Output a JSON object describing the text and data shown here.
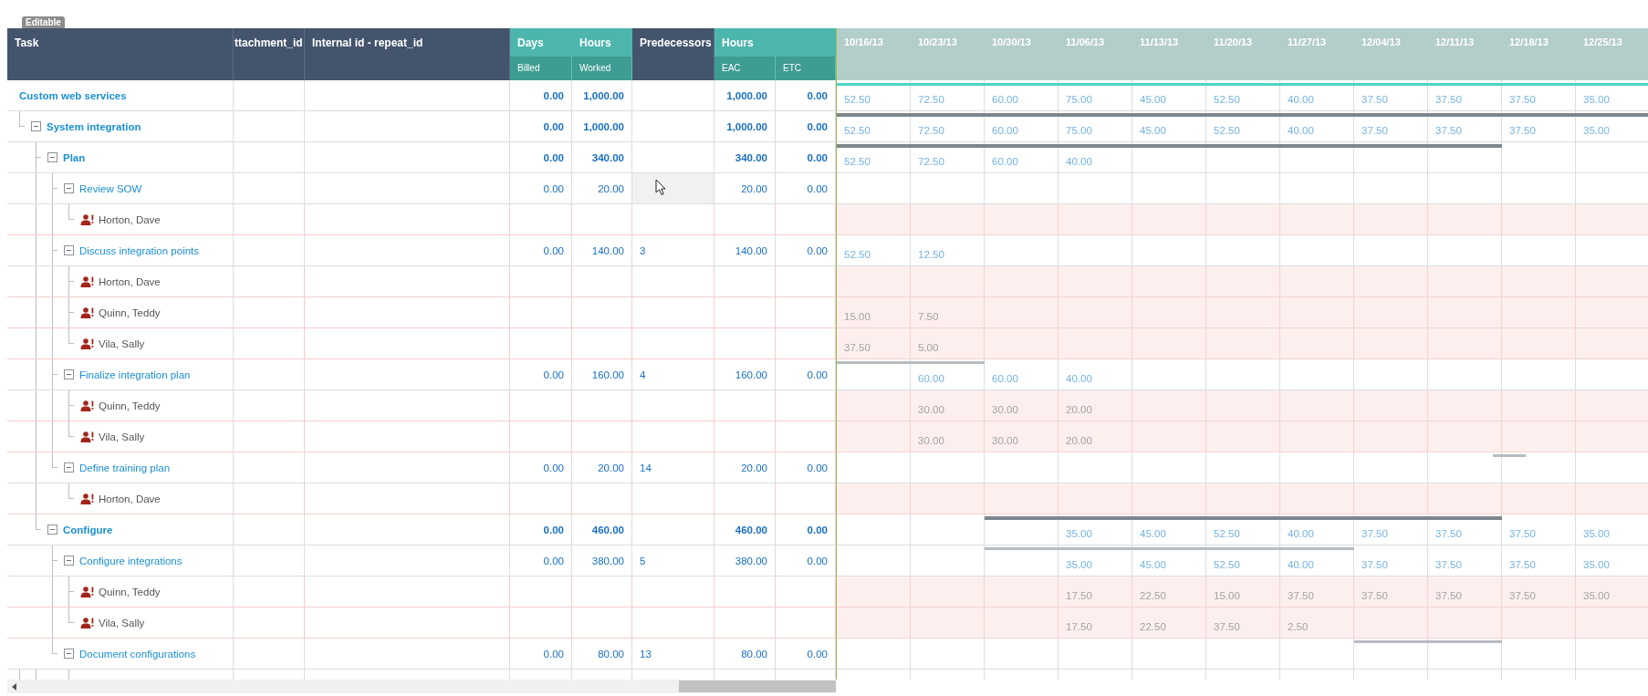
{
  "badge": "Editable",
  "header": {
    "task": "Task",
    "column_2": "ttachment_id",
    "internal_id": "Internal id - repeat_id",
    "days": "Days",
    "hours": "Hours",
    "billed": "Billed",
    "worked": "Worked",
    "predecessors": "Predecessors",
    "hours_2": "Hours",
    "eac": "EAC",
    "etc": "ETC"
  },
  "weeks": [
    "10/16/13",
    "10/23/13",
    "10/30/13",
    "11/06/13",
    "11/13/13",
    "11/20/13",
    "11/27/13",
    "12/04/13",
    "12/11/13",
    "12/18/13",
    "12/25/13"
  ],
  "rows": [
    {
      "kind": "task",
      "name": "Custom web services",
      "bold": true,
      "selected": false,
      "billed": "0.00",
      "worked": "1,000.00",
      "eac": "1,000.00",
      "etc": "0.00",
      "timeline": [
        {
          "value": "52.50",
          "bar": false
        },
        {
          "value": "72.50",
          "bar": false
        },
        {
          "value": "60.00",
          "bar": false
        },
        {
          "value": "75.00",
          "bar": false
        },
        {
          "value": "45.00",
          "bar": false
        },
        {
          "value": "52.50",
          "bar": false
        },
        {
          "value": "40.00",
          "bar": false
        },
        {
          "value": "37.50",
          "bar": false
        },
        {
          "value": "37.50",
          "bar": false
        },
        {
          "value": "37.50",
          "bar": false
        },
        {
          "value": "35.00",
          "bar": false
        }
      ],
      "children": [
        {
          "kind": "task",
          "name": "System integration",
          "bold": true,
          "expanded": true,
          "selected": false,
          "billed": "0.00",
          "worked": "1,000.00",
          "eac": "1,000.00",
          "etc": "0.00",
          "bar": {
            "kind": "summary"
          },
          "timeline": [
            {
              "value": "52.50",
              "bar": true
            },
            {
              "value": "72.50",
              "bar": true
            },
            {
              "value": "60.00",
              "bar": true
            },
            {
              "value": "75.00",
              "bar": true
            },
            {
              "value": "45.00",
              "bar": true
            },
            {
              "value": "52.50",
              "bar": true
            },
            {
              "value": "40.00",
              "bar": true
            },
            {
              "value": "37.50",
              "bar": true
            },
            {
              "value": "37.50",
              "bar": true
            },
            {
              "value": "37.50",
              "bar": true
            },
            {
              "value": "35.00",
              "bar": true
            }
          ],
          "children": [
            {
              "kind": "task",
              "name": "Plan",
              "bold": true,
              "expanded": true,
              "selected": false,
              "billed": "0.00",
              "worked": "340.00",
              "eac": "340.00",
              "etc": "0.00",
              "bar": {
                "kind": "summary"
              },
              "timeline": [
                {
                  "value": "52.50",
                  "bar": true
                },
                {
                  "value": "72.50",
                  "bar": true
                },
                {
                  "value": "60.00",
                  "bar": true
                },
                {
                  "value": "40.00",
                  "bar": true
                },
                {
                  "bar": true
                },
                {
                  "bar": true
                },
                {
                  "bar": true
                },
                {
                  "bar": true
                },
                {
                  "bar": true
                },
                {
                  "bar": false
                },
                {
                  "bar": false
                }
              ],
              "children": [
                {
                  "kind": "task",
                  "name": "Review SOW",
                  "bold": false,
                  "expanded": true,
                  "selected": true,
                  "billed": "0.00",
                  "worked": "20.00",
                  "eac": "20.00",
                  "etc": "0.00",
                  "children": [
                    {
                      "kind": "resource",
                      "name": "Horton, Dave",
                      "selected": false
                    }
                  ]
                },
                {
                  "kind": "task",
                  "name": "Discuss integration points",
                  "bold": false,
                  "expanded": true,
                  "selected": false,
                  "billed": "0.00",
                  "worked": "140.00",
                  "predecessors": "3",
                  "eac": "140.00",
                  "etc": "0.00",
                  "timeline": [
                    {
                      "value": "52.50",
                      "bar": false
                    },
                    {
                      "value": "12.50",
                      "bar": false
                    },
                    {
                      "bar": false
                    },
                    {
                      "bar": false
                    },
                    {
                      "bar": false
                    },
                    {
                      "bar": false
                    },
                    {
                      "bar": false
                    },
                    {
                      "bar": false
                    },
                    {
                      "bar": false
                    },
                    {
                      "bar": false
                    },
                    {
                      "bar": false
                    }
                  ],
                  "children": [
                    {
                      "kind": "resource",
                      "name": "Horton, Dave",
                      "selected": false
                    },
                    {
                      "kind": "resource",
                      "name": "Quinn, Teddy",
                      "selected": false,
                      "timeline": [
                        {
                          "value": "15.00",
                          "bar": false
                        },
                        {
                          "value": "7.50",
                          "bar": false
                        },
                        {
                          "bar": false
                        },
                        {
                          "bar": false
                        },
                        {
                          "bar": false
                        },
                        {
                          "bar": false
                        },
                        {
                          "bar": false
                        },
                        {
                          "bar": false
                        },
                        {
                          "bar": false
                        },
                        {
                          "bar": false
                        },
                        {
                          "bar": false
                        }
                      ]
                    },
                    {
                      "kind": "resource",
                      "name": "Vila, Sally",
                      "selected": false,
                      "timeline": [
                        {
                          "value": "37.50",
                          "bar": false
                        },
                        {
                          "value": "5.00",
                          "bar": false
                        },
                        {
                          "bar": false
                        },
                        {
                          "bar": false
                        },
                        {
                          "bar": false
                        },
                        {
                          "bar": false
                        },
                        {
                          "bar": false
                        },
                        {
                          "bar": false
                        },
                        {
                          "bar": false
                        },
                        {
                          "bar": false
                        },
                        {
                          "bar": false
                        }
                      ]
                    }
                  ]
                },
                {
                  "kind": "task",
                  "name": "Finalize integration plan",
                  "bold": false,
                  "expanded": true,
                  "selected": false,
                  "billed": "0.00",
                  "worked": "160.00",
                  "predecessors": "4",
                  "eac": "160.00",
                  "etc": "0.00",
                  "bar": {
                    "kind": "task"
                  },
                  "timeline": [
                    {
                      "bar": true
                    },
                    {
                      "value": "60.00",
                      "bar": true
                    },
                    {
                      "value": "60.00",
                      "bar": false
                    },
                    {
                      "value": "40.00",
                      "bar": false
                    },
                    {
                      "bar": false
                    },
                    {
                      "bar": false
                    },
                    {
                      "bar": false
                    },
                    {
                      "bar": false
                    },
                    {
                      "bar": false
                    },
                    {
                      "bar": false
                    },
                    {
                      "bar": false
                    }
                  ],
                  "children": [
                    {
                      "kind": "resource",
                      "name": "Quinn, Teddy",
                      "selected": false,
                      "timeline": [
                        {
                          "bar": false
                        },
                        {
                          "value": "30.00",
                          "bar": false
                        },
                        {
                          "value": "30.00",
                          "bar": false
                        },
                        {
                          "value": "20.00",
                          "bar": false
                        },
                        {
                          "bar": false
                        },
                        {
                          "bar": false
                        },
                        {
                          "bar": false
                        },
                        {
                          "bar": false
                        },
                        {
                          "bar": false
                        },
                        {
                          "bar": false
                        },
                        {
                          "bar": false
                        }
                      ]
                    },
                    {
                      "kind": "resource",
                      "name": "Vila, Sally",
                      "selected": false,
                      "timeline": [
                        {
                          "bar": false
                        },
                        {
                          "value": "30.00",
                          "bar": false
                        },
                        {
                          "value": "30.00",
                          "bar": false
                        },
                        {
                          "value": "20.00",
                          "bar": false
                        },
                        {
                          "bar": false
                        },
                        {
                          "bar": false
                        },
                        {
                          "bar": false
                        },
                        {
                          "bar": false
                        },
                        {
                          "bar": false
                        },
                        {
                          "bar": false
                        },
                        {
                          "bar": false
                        }
                      ]
                    }
                  ]
                },
                {
                  "kind": "task",
                  "name": "Define training plan",
                  "bold": false,
                  "expanded": true,
                  "selected": false,
                  "billed": "0.00",
                  "worked": "20.00",
                  "predecessors": "14",
                  "eac": "20.00",
                  "etc": "0.00",
                  "bar": {
                    "kind": "milestone"
                  },
                  "timeline": [
                    {
                      "bar": false
                    },
                    {
                      "bar": false
                    },
                    {
                      "bar": false
                    },
                    {
                      "bar": false
                    },
                    {
                      "bar": false
                    },
                    {
                      "bar": false
                    },
                    {
                      "bar": false
                    },
                    {
                      "bar": false
                    },
                    {
                      "bar": false
                    },
                    {
                      "bar": true
                    },
                    {
                      "bar": false
                    }
                  ],
                  "children": [
                    {
                      "kind": "resource",
                      "name": "Horton, Dave",
                      "selected": false
                    }
                  ]
                }
              ]
            },
            {
              "kind": "task",
              "name": "Configure",
              "bold": true,
              "expanded": true,
              "selected": false,
              "billed": "0.00",
              "worked": "460.00",
              "eac": "460.00",
              "etc": "0.00",
              "bar": {
                "kind": "summary"
              },
              "timeline": [
                {
                  "bar": false
                },
                {
                  "bar": false
                },
                {
                  "bar": true
                },
                {
                  "value": "35.00",
                  "bar": true
                },
                {
                  "value": "45.00",
                  "bar": true
                },
                {
                  "value": "52.50",
                  "bar": true
                },
                {
                  "value": "40.00",
                  "bar": true
                },
                {
                  "value": "37.50",
                  "bar": true
                },
                {
                  "value": "37.50",
                  "bar": true
                },
                {
                  "value": "37.50",
                  "bar": false
                },
                {
                  "value": "35.00",
                  "bar": false
                }
              ],
              "children": [
                {
                  "kind": "task",
                  "name": "Configure integrations",
                  "bold": false,
                  "expanded": true,
                  "selected": false,
                  "billed": "0.00",
                  "worked": "380.00",
                  "predecessors": "5",
                  "eac": "380.00",
                  "etc": "0.00",
                  "bar": {
                    "kind": "task"
                  },
                  "timeline": [
                    {
                      "bar": false
                    },
                    {
                      "bar": false
                    },
                    {
                      "bar": true
                    },
                    {
                      "value": "35.00",
                      "bar": true
                    },
                    {
                      "value": "45.00",
                      "bar": true
                    },
                    {
                      "value": "52.50",
                      "bar": true
                    },
                    {
                      "value": "40.00",
                      "bar": true
                    },
                    {
                      "value": "37.50",
                      "bar": false
                    },
                    {
                      "value": "37.50",
                      "bar": false
                    },
                    {
                      "value": "37.50",
                      "bar": false
                    },
                    {
                      "value": "35.00",
                      "bar": false
                    }
                  ],
                  "children": [
                    {
                      "kind": "resource",
                      "name": "Quinn, Teddy",
                      "selected": false,
                      "timeline": [
                        {
                          "bar": false
                        },
                        {
                          "bar": false
                        },
                        {
                          "bar": false
                        },
                        {
                          "value": "17.50",
                          "bar": false
                        },
                        {
                          "value": "22.50",
                          "bar": false
                        },
                        {
                          "value": "15.00",
                          "bar": false
                        },
                        {
                          "value": "37.50",
                          "bar": false
                        },
                        {
                          "value": "37.50",
                          "bar": false
                        },
                        {
                          "value": "37.50",
                          "bar": false
                        },
                        {
                          "value": "37.50",
                          "bar": false
                        },
                        {
                          "value": "35.00",
                          "bar": false
                        }
                      ]
                    },
                    {
                      "kind": "resource",
                      "name": "Vila, Sally",
                      "selected": false,
                      "timeline": [
                        {
                          "bar": false
                        },
                        {
                          "bar": false
                        },
                        {
                          "bar": false
                        },
                        {
                          "value": "17.50",
                          "bar": false
                        },
                        {
                          "value": "22.50",
                          "bar": false
                        },
                        {
                          "value": "37.50",
                          "bar": false
                        },
                        {
                          "value": "2.50",
                          "bar": false
                        },
                        {
                          "bar": false
                        },
                        {
                          "bar": false
                        },
                        {
                          "bar": false
                        },
                        {
                          "bar": false
                        }
                      ]
                    }
                  ]
                },
                {
                  "kind": "task",
                  "name": "Document configurations",
                  "bold": false,
                  "expanded": true,
                  "selected": false,
                  "billed": "0.00",
                  "worked": "80.00",
                  "predecessors": "13",
                  "eac": "80.00",
                  "etc": "0.00",
                  "bar": {
                    "kind": "task"
                  },
                  "timeline": [
                    {
                      "bar": false
                    },
                    {
                      "bar": false
                    },
                    {
                      "bar": false
                    },
                    {
                      "bar": false
                    },
                    {
                      "bar": false
                    },
                    {
                      "bar": false
                    },
                    {
                      "bar": false
                    },
                    {
                      "bar": true
                    },
                    {
                      "bar": true
                    },
                    {
                      "bar": false
                    },
                    {
                      "bar": false
                    }
                  ]
                }
              ]
            }
          ]
        }
      ]
    }
  ]
}
